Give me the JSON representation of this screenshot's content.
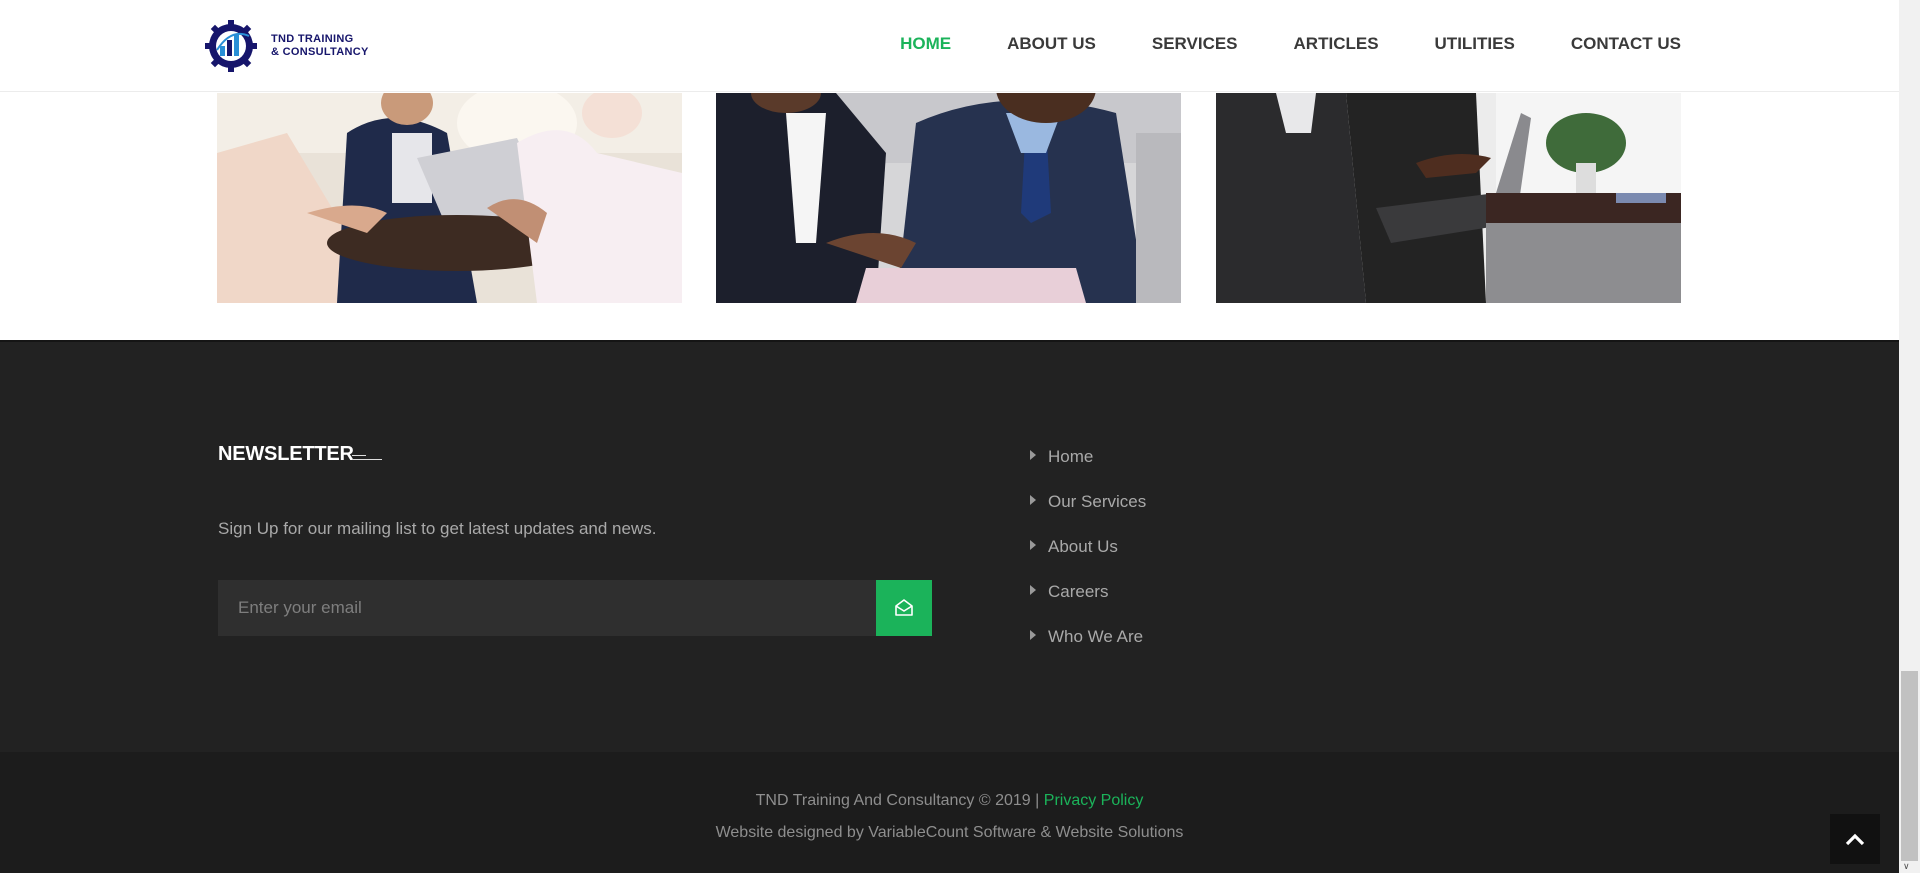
{
  "header": {
    "logo": {
      "line1": "TND TRAINING",
      "line2": "& CONSULTANCY"
    },
    "nav": [
      {
        "label": "HOME"
      },
      {
        "label": "ABOUT US"
      },
      {
        "label": "SERVICES"
      },
      {
        "label": "ARTICLES"
      },
      {
        "label": "UTILITIES"
      },
      {
        "label": "CONTACT US"
      }
    ],
    "active_index": 0
  },
  "photos": [
    {
      "description_icon": "meeting-photo"
    },
    {
      "description_icon": "handshake-photo"
    },
    {
      "description_icon": "laptop-presentation-photo"
    }
  ],
  "newsletter": {
    "title": "NEWSLETTER",
    "description": "Sign Up for our mailing list to get latest updates and news.",
    "placeholder": "Enter your email",
    "submit_icon": "envelope-open-icon"
  },
  "footer_links": [
    {
      "label": "Home"
    },
    {
      "label": "Our Services"
    },
    {
      "label": "About Us"
    },
    {
      "label": "Careers"
    },
    {
      "label": "Who We Are"
    }
  ],
  "bottom": {
    "copyright": "TND Training And Consultancy © 2019 |",
    "privacy": "Privacy Policy",
    "credit": "Website designed by VariableCount Software & Website Solutions"
  },
  "colors": {
    "accent": "#1bb35a",
    "footer_bg": "#222222",
    "bottom_bg": "#1c1c1c",
    "logo_navy": "#16156b"
  }
}
